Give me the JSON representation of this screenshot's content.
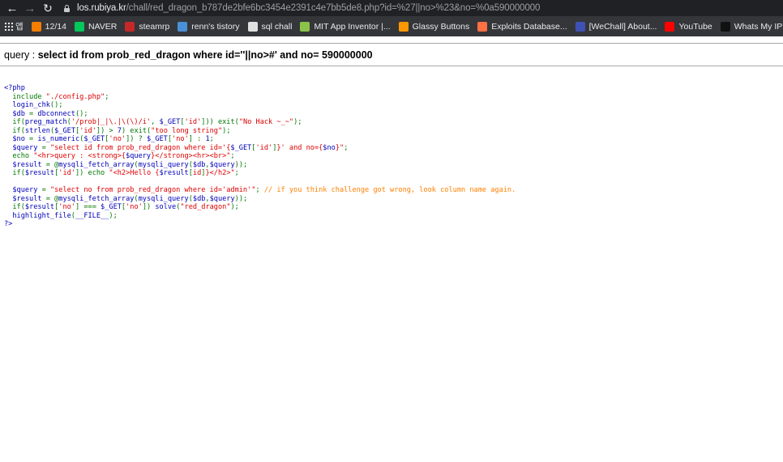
{
  "browser": {
    "url_host": "los.rubiya.kr",
    "url_rest": "/chall/red_dragon_b787de2bfe6bc3454e2391c4e7bb5de8.php?id=%27||no>%23&no=%0a590000000",
    "bookmarks": [
      {
        "label": "앱",
        "icon": "apps-grid-icon",
        "color": "#e8eaed"
      },
      {
        "label": "12/14",
        "icon": "blogger-icon",
        "color": "#f57d00"
      },
      {
        "label": "NAVER",
        "icon": "naver-icon",
        "color": "#03c75a"
      },
      {
        "label": "steamrp",
        "icon": "steamrp-icon",
        "color": "#c62828"
      },
      {
        "label": "renn's tistory",
        "icon": "tistory-icon",
        "color": "#4a90d9"
      },
      {
        "label": "sql chall",
        "icon": "z-icon",
        "color": "#e0e0e0"
      },
      {
        "label": "MIT App Inventor |...",
        "icon": "app-inventor-icon",
        "color": "#8bc34a"
      },
      {
        "label": "Glassy Buttons",
        "icon": "glassy-icon",
        "color": "#ff9800"
      },
      {
        "label": "Exploits Database...",
        "icon": "exploit-db-icon",
        "color": "#ff7043"
      },
      {
        "label": "[WeChall] About...",
        "icon": "wechall-icon",
        "color": "#3f51b5"
      },
      {
        "label": "YouTube",
        "icon": "youtube-icon",
        "color": "#ff0000"
      },
      {
        "label": "Whats My IP Addr...",
        "icon": "ip-icon",
        "color": "#111111"
      }
    ]
  },
  "page": {
    "query_label": "query : ",
    "query_text": "select id from prob_red_dragon where id=''||no>#' and no= 590000000"
  },
  "source": [
    [
      [
        "c-def",
        "<?php"
      ]
    ],
    [
      [
        "c-def",
        "  "
      ],
      [
        "c-kw",
        "include "
      ],
      [
        "c-str",
        "\"./config.php\""
      ],
      [
        "c-kw",
        ";"
      ]
    ],
    [
      [
        "c-def",
        "  login_chk"
      ],
      [
        "c-kw",
        "();"
      ]
    ],
    [
      [
        "c-def",
        "  $db "
      ],
      [
        "c-kw",
        "= "
      ],
      [
        "c-def",
        "dbconnect"
      ],
      [
        "c-kw",
        "();"
      ]
    ],
    [
      [
        "c-def",
        "  "
      ],
      [
        "c-kw",
        "if("
      ],
      [
        "c-def",
        "preg_match"
      ],
      [
        "c-kw",
        "("
      ],
      [
        "c-str",
        "'/prob|_|\\.|\\(\\)/i'"
      ],
      [
        "c-kw",
        ", "
      ],
      [
        "c-def",
        "$_GET"
      ],
      [
        "c-kw",
        "["
      ],
      [
        "c-str",
        "'id'"
      ],
      [
        "c-kw",
        "])) exit("
      ],
      [
        "c-str",
        "\"No Hack ~_~\""
      ],
      [
        "c-kw",
        ");"
      ]
    ],
    [
      [
        "c-def",
        "  "
      ],
      [
        "c-kw",
        "if("
      ],
      [
        "c-def",
        "strlen"
      ],
      [
        "c-kw",
        "("
      ],
      [
        "c-def",
        "$_GET"
      ],
      [
        "c-kw",
        "["
      ],
      [
        "c-str",
        "'id'"
      ],
      [
        "c-kw",
        "]) > "
      ],
      [
        "c-def",
        "7"
      ],
      [
        "c-kw",
        ") exit("
      ],
      [
        "c-str",
        "\"too long string\""
      ],
      [
        "c-kw",
        ");"
      ]
    ],
    [
      [
        "c-def",
        "  $no "
      ],
      [
        "c-kw",
        "= "
      ],
      [
        "c-def",
        "is_numeric"
      ],
      [
        "c-kw",
        "("
      ],
      [
        "c-def",
        "$_GET"
      ],
      [
        "c-kw",
        "["
      ],
      [
        "c-str",
        "'no'"
      ],
      [
        "c-kw",
        "]) ? "
      ],
      [
        "c-def",
        "$_GET"
      ],
      [
        "c-kw",
        "["
      ],
      [
        "c-str",
        "'no'"
      ],
      [
        "c-kw",
        "] : "
      ],
      [
        "c-def",
        "1"
      ],
      [
        "c-kw",
        ";"
      ]
    ],
    [
      [
        "c-def",
        "  $query "
      ],
      [
        "c-kw",
        "= "
      ],
      [
        "c-str",
        "\"select id from prob_red_dragon where id='{"
      ],
      [
        "c-def",
        "$_GET"
      ],
      [
        "c-kw",
        "["
      ],
      [
        "c-str",
        "'id'"
      ],
      [
        "c-kw",
        "]"
      ],
      [
        "c-str",
        "}' and no={"
      ],
      [
        "c-def",
        "$no"
      ],
      [
        "c-str",
        "}\""
      ],
      [
        "c-kw",
        ";"
      ]
    ],
    [
      [
        "c-def",
        "  "
      ],
      [
        "c-kw",
        "echo "
      ],
      [
        "c-str",
        "\"<hr>query : <strong>{"
      ],
      [
        "c-def",
        "$query"
      ],
      [
        "c-str",
        "}</strong><hr><br>\""
      ],
      [
        "c-kw",
        ";"
      ]
    ],
    [
      [
        "c-def",
        "  $result "
      ],
      [
        "c-kw",
        "= @"
      ],
      [
        "c-def",
        "mysqli_fetch_array"
      ],
      [
        "c-kw",
        "("
      ],
      [
        "c-def",
        "mysqli_query"
      ],
      [
        "c-kw",
        "("
      ],
      [
        "c-def",
        "$db"
      ],
      [
        "c-kw",
        ","
      ],
      [
        "c-def",
        "$query"
      ],
      [
        "c-kw",
        "));"
      ]
    ],
    [
      [
        "c-def",
        "  "
      ],
      [
        "c-kw",
        "if("
      ],
      [
        "c-def",
        "$result"
      ],
      [
        "c-kw",
        "["
      ],
      [
        "c-str",
        "'id'"
      ],
      [
        "c-kw",
        "]) echo "
      ],
      [
        "c-str",
        "\"<h2>Hello {"
      ],
      [
        "c-def",
        "$result"
      ],
      [
        "c-kw",
        "["
      ],
      [
        "c-str",
        "id"
      ],
      [
        "c-kw",
        "]"
      ],
      [
        "c-str",
        "}</h2>\""
      ],
      [
        "c-kw",
        ";"
      ]
    ],
    [
      [
        "c-def",
        " "
      ]
    ],
    [
      [
        "c-def",
        "  $query "
      ],
      [
        "c-kw",
        "= "
      ],
      [
        "c-str",
        "\"select no from prob_red_dragon where id='admin'\""
      ],
      [
        "c-kw",
        "; "
      ],
      [
        "c-com",
        "// if you think challenge got wrong, look column name again."
      ]
    ],
    [
      [
        "c-def",
        "  $result "
      ],
      [
        "c-kw",
        "= @"
      ],
      [
        "c-def",
        "mysqli_fetch_array"
      ],
      [
        "c-kw",
        "("
      ],
      [
        "c-def",
        "mysqli_query"
      ],
      [
        "c-kw",
        "("
      ],
      [
        "c-def",
        "$db"
      ],
      [
        "c-kw",
        ","
      ],
      [
        "c-def",
        "$query"
      ],
      [
        "c-kw",
        "));"
      ]
    ],
    [
      [
        "c-def",
        "  "
      ],
      [
        "c-kw",
        "if("
      ],
      [
        "c-def",
        "$result"
      ],
      [
        "c-kw",
        "["
      ],
      [
        "c-str",
        "'no'"
      ],
      [
        "c-kw",
        "] === "
      ],
      [
        "c-def",
        "$_GET"
      ],
      [
        "c-kw",
        "["
      ],
      [
        "c-str",
        "'no'"
      ],
      [
        "c-kw",
        "]) "
      ],
      [
        "c-def",
        "solve"
      ],
      [
        "c-kw",
        "("
      ],
      [
        "c-str",
        "\"red_dragon\""
      ],
      [
        "c-kw",
        ");"
      ]
    ],
    [
      [
        "c-def",
        "  highlight_file"
      ],
      [
        "c-kw",
        "("
      ],
      [
        "c-def",
        "__FILE__"
      ],
      [
        "c-kw",
        ");"
      ]
    ],
    [
      [
        "c-def",
        "?>"
      ]
    ]
  ]
}
